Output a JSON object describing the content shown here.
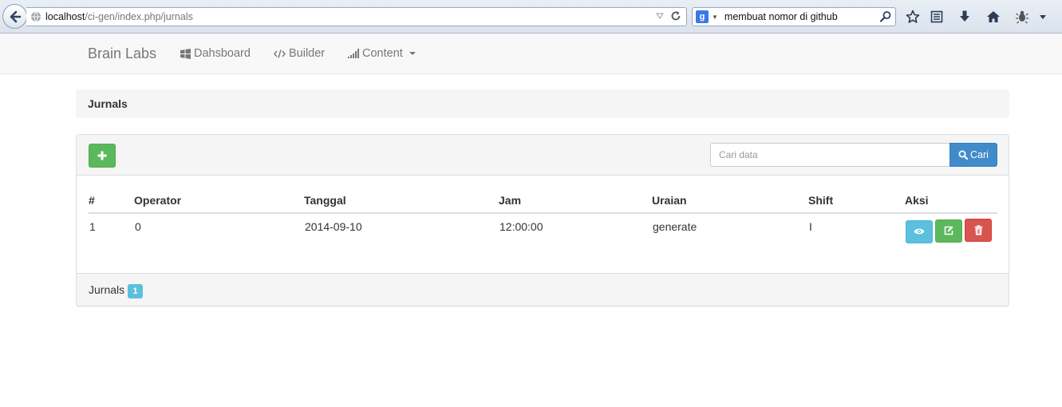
{
  "browser": {
    "url_host": "localhost",
    "url_path": "/ci-gen/index.php/jurnals",
    "search_query": "membuat nomor di github",
    "search_engine_icon": "google-g-icon"
  },
  "navbar": {
    "brand": "Brain Labs",
    "items": [
      {
        "label": "Dahsboard",
        "icon": "windows-icon"
      },
      {
        "label": "Builder",
        "icon": "code-icon"
      },
      {
        "label": "Content",
        "icon": "signal-icon",
        "has_dropdown": true
      }
    ]
  },
  "page": {
    "title": "Jurnals"
  },
  "toolbar": {
    "add_icon": "plus-icon",
    "search_placeholder": "Cari data",
    "search_button_label": "Cari"
  },
  "table": {
    "columns": [
      "#",
      "Operator",
      "Tanggal",
      "Jam",
      "Uraian",
      "Shift",
      "Aksi"
    ],
    "rows": [
      {
        "no": "1",
        "operator": "0",
        "tanggal": "2014-09-10",
        "jam": "12:00:00",
        "uraian": "generate",
        "shift": "I"
      }
    ]
  },
  "footer": {
    "label": "Jurnals",
    "count": "1"
  },
  "colors": {
    "success": "#5cb85c",
    "primary": "#428bca",
    "info": "#5bc0de",
    "danger": "#d9534f"
  }
}
